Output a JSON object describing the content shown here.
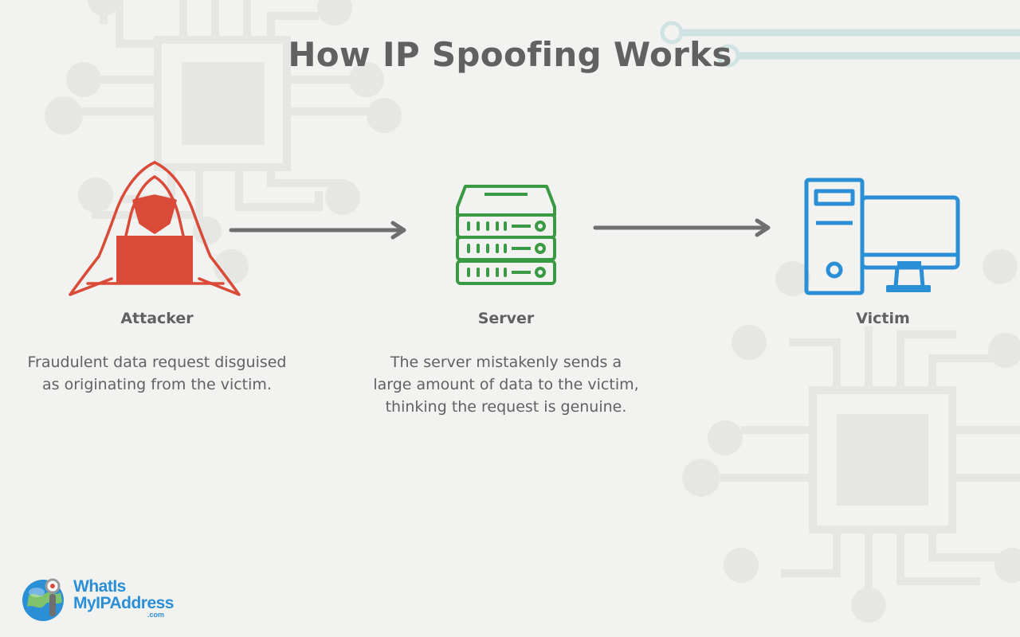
{
  "title": "How IP Spoofing Works",
  "nodes": [
    {
      "label": "Attacker",
      "description": [
        "Fraudulent data request disguised",
        "as originating from the victim."
      ]
    },
    {
      "label": "Server",
      "description": [
        "The server mistakenly sends a",
        "large amount of data to the victim,",
        "thinking the request is genuine."
      ]
    },
    {
      "label": "Victim",
      "description": []
    }
  ],
  "icons": {
    "attacker": "hooded-hacker-icon",
    "server": "server-rack-icon",
    "victim": "desktop-computer-icon"
  },
  "colors": {
    "attacker": "#d94a38",
    "server": "#3a9a44",
    "victim": "#2b8fd6",
    "text": "#616161",
    "arrow": "#6f6f6f"
  },
  "logo": {
    "line1": "WhatIs",
    "line2": "MyIPAddress",
    "line3": ".com"
  }
}
